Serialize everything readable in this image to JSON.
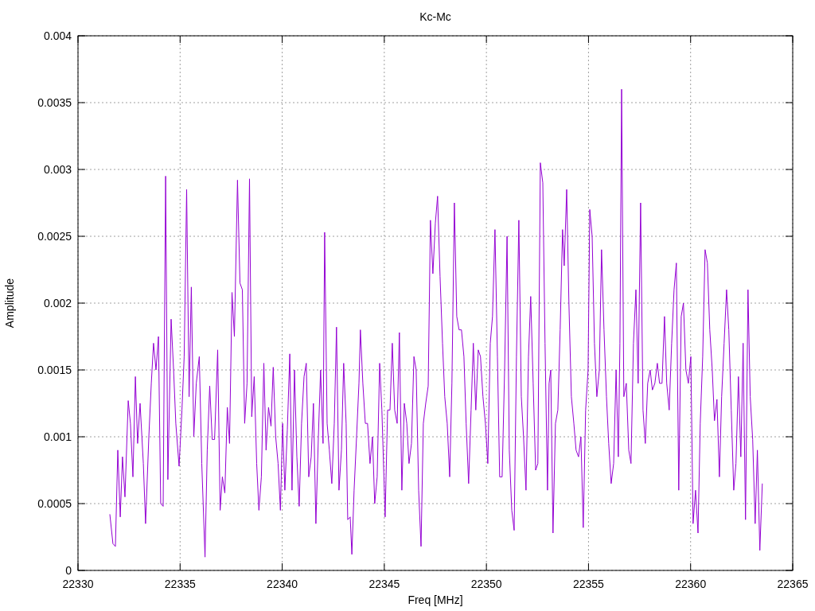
{
  "chart": {
    "chart_data": {
      "type": "line",
      "title": "Kc-Mc",
      "xlabel": "Freq [MHz]",
      "ylabel": "Amplitude",
      "grid": true,
      "xlim": [
        22330,
        22365
      ],
      "ylim": [
        0,
        0.004
      ],
      "xticks": [
        {
          "value": 22330,
          "label": "22330"
        },
        {
          "value": 22335,
          "label": "22335"
        },
        {
          "value": 22340,
          "label": "22340"
        },
        {
          "value": 22345,
          "label": "22345"
        },
        {
          "value": 22350,
          "label": "22350"
        },
        {
          "value": 22355,
          "label": "22355"
        },
        {
          "value": 22360,
          "label": "22360"
        },
        {
          "value": 22365,
          "label": "22365"
        }
      ],
      "yticks": [
        {
          "value": 0,
          "label": "0"
        },
        {
          "value": 0.0005,
          "label": "0.0005"
        },
        {
          "value": 0.001,
          "label": "0.001"
        },
        {
          "value": 0.0015,
          "label": "0.0015"
        },
        {
          "value": 0.002,
          "label": "0.002"
        },
        {
          "value": 0.0025,
          "label": "0.0025"
        },
        {
          "value": 0.003,
          "label": "0.003"
        },
        {
          "value": 0.0035,
          "label": "0.0035"
        },
        {
          "value": 0.004,
          "label": "0.004"
        }
      ],
      "x": [
        22331.56,
        22331.71,
        22331.83,
        22331.95,
        22332.07,
        22332.18,
        22332.3,
        22332.46,
        22332.57,
        22332.69,
        22332.81,
        22332.92,
        22333.04,
        22333.2,
        22333.31,
        22333.47,
        22333.59,
        22333.7,
        22333.82,
        22333.94,
        22334.05,
        22334.17,
        22334.29,
        22334.4,
        22334.56,
        22334.68,
        22334.79,
        22334.95,
        22335.09,
        22335.2,
        22335.32,
        22335.44,
        22335.55,
        22335.67,
        22335.79,
        22335.94,
        22336.06,
        22336.22,
        22336.33,
        22336.45,
        22336.57,
        22336.69,
        22336.84,
        22336.96,
        22337.07,
        22337.19,
        22337.31,
        22337.42,
        22337.54,
        22337.66,
        22337.81,
        22337.93,
        22338.05,
        22338.16,
        22338.28,
        22338.4,
        22338.51,
        22338.63,
        22338.75,
        22338.86,
        22338.98,
        22339.1,
        22339.21,
        22339.33,
        22339.45,
        22339.56,
        22339.68,
        22339.8,
        22339.91,
        22340.02,
        22340.13,
        22340.25,
        22340.37,
        22340.48,
        22340.6,
        22340.72,
        22340.83,
        22340.95,
        22341.07,
        22341.18,
        22341.3,
        22341.42,
        22341.53,
        22341.65,
        22341.77,
        22341.88,
        22342.0,
        22342.08,
        22342.2,
        22342.31,
        22342.43,
        22342.55,
        22342.66,
        22342.78,
        22342.9,
        22343.01,
        22343.13,
        22343.21,
        22343.33,
        22343.41,
        22343.52,
        22343.64,
        22343.76,
        22343.83,
        22343.95,
        22344.07,
        22344.18,
        22344.3,
        22344.42,
        22344.53,
        22344.65,
        22344.77,
        22344.88,
        22345.04,
        22345.16,
        22345.28,
        22345.39,
        22345.51,
        22345.63,
        22345.74,
        22345.86,
        22345.98,
        22346.1,
        22346.21,
        22346.33,
        22346.45,
        22346.56,
        22346.68,
        22346.8,
        22346.91,
        22347.03,
        22347.15,
        22347.26,
        22347.38,
        22347.5,
        22347.61,
        22347.73,
        22347.85,
        22347.96,
        22348.08,
        22348.2,
        22348.31,
        22348.43,
        22348.55,
        22348.66,
        22348.78,
        22348.9,
        22349.01,
        22349.13,
        22349.25,
        22349.36,
        22349.48,
        22349.6,
        22349.71,
        22349.83,
        22349.95,
        22350.07,
        22350.19,
        22350.3,
        22350.42,
        22350.54,
        22350.65,
        22350.77,
        22350.89,
        22351.01,
        22351.12,
        22351.24,
        22351.36,
        22351.47,
        22351.59,
        22351.71,
        22351.82,
        22351.94,
        22352.06,
        22352.17,
        22352.29,
        22352.41,
        22352.52,
        22352.64,
        22352.76,
        22352.87,
        22352.99,
        22353.07,
        22353.15,
        22353.26,
        22353.38,
        22353.5,
        22353.61,
        22353.73,
        22353.81,
        22353.93,
        22354.04,
        22354.16,
        22354.28,
        22354.39,
        22354.51,
        22354.63,
        22354.74,
        22354.86,
        22354.98,
        22355.06,
        22355.18,
        22355.29,
        22355.41,
        22355.53,
        22355.64,
        22355.76,
        22355.88,
        22355.99,
        22356.11,
        22356.23,
        22356.35,
        22356.46,
        22356.54,
        22356.62,
        22356.73,
        22356.85,
        22356.97,
        22357.08,
        22357.2,
        22357.32,
        22357.43,
        22357.55,
        22357.67,
        22357.78,
        22357.9,
        22358.02,
        22358.13,
        22358.25,
        22358.37,
        22358.48,
        22358.6,
        22358.72,
        22358.83,
        22358.95,
        22359.07,
        22359.19,
        22359.3,
        22359.42,
        22359.54,
        22359.65,
        22359.77,
        22359.89,
        22360.01,
        22360.12,
        22360.24,
        22360.36,
        22360.47,
        22360.59,
        22360.71,
        22360.82,
        22360.94,
        22361.06,
        22361.17,
        22361.29,
        22361.41,
        22361.52,
        22361.64,
        22361.76,
        22361.87,
        22361.99,
        22362.11,
        22362.22,
        22362.34,
        22362.46,
        22362.57,
        22362.69,
        22362.81,
        22362.92,
        22363.04,
        22363.16,
        22363.27,
        22363.39,
        22363.51
      ],
      "series": [
        {
          "color": "#9400d3",
          "values": [
            0.00042,
            0.0002,
            0.00018,
            0.0009,
            0.0004,
            0.00085,
            0.00055,
            0.00127,
            0.0011,
            0.0007,
            0.00145,
            0.00095,
            0.00125,
            0.0008,
            0.00035,
            0.001,
            0.0014,
            0.0017,
            0.0015,
            0.00175,
            0.0005,
            0.00048,
            0.00295,
            0.00068,
            0.00188,
            0.0015,
            0.0011,
            0.00078,
            0.0012,
            0.0016,
            0.00285,
            0.0013,
            0.00212,
            0.001,
            0.0014,
            0.0016,
            0.0008,
            0.0001,
            0.0009,
            0.00138,
            0.00098,
            0.00098,
            0.00165,
            0.00045,
            0.0007,
            0.00058,
            0.00122,
            0.00095,
            0.00208,
            0.00175,
            0.00292,
            0.00215,
            0.0021,
            0.0011,
            0.0014,
            0.00293,
            0.00115,
            0.00145,
            0.0008,
            0.00045,
            0.0007,
            0.00155,
            0.0009,
            0.00122,
            0.00108,
            0.00152,
            0.001,
            0.0008,
            0.00045,
            0.0011,
            0.0006,
            0.00105,
            0.00162,
            0.0006,
            0.0015,
            0.00085,
            0.00048,
            0.0011,
            0.00145,
            0.00155,
            0.0007,
            0.00085,
            0.00125,
            0.00035,
            0.001,
            0.0015,
            0.00095,
            0.00253,
            0.0011,
            0.0009,
            0.00065,
            0.0011,
            0.00182,
            0.0006,
            0.0009,
            0.00155,
            0.0011,
            0.00038,
            0.0004,
            0.00012,
            0.0006,
            0.001,
            0.0014,
            0.0018,
            0.0014,
            0.0011,
            0.0011,
            0.0008,
            0.001,
            0.0005,
            0.0007,
            0.00155,
            0.0012,
            0.0004,
            0.0012,
            0.0012,
            0.0017,
            0.0012,
            0.0011,
            0.00178,
            0.0006,
            0.00125,
            0.0011,
            0.0008,
            0.00095,
            0.0016,
            0.0015,
            0.0006,
            0.00018,
            0.0011,
            0.00125,
            0.00138,
            0.00262,
            0.00222,
            0.0026,
            0.0028,
            0.0022,
            0.0017,
            0.0013,
            0.0011,
            0.0007,
            0.0014,
            0.00275,
            0.0019,
            0.0018,
            0.0018,
            0.0016,
            0.0011,
            0.00065,
            0.0012,
            0.0017,
            0.0012,
            0.00165,
            0.0016,
            0.0013,
            0.0011,
            0.0008,
            0.0017,
            0.0019,
            0.00255,
            0.0016,
            0.0007,
            0.0007,
            0.0015,
            0.0025,
            0.0009,
            0.00045,
            0.0003,
            0.0016,
            0.00262,
            0.0013,
            0.001,
            0.0006,
            0.0016,
            0.00205,
            0.0014,
            0.00075,
            0.0008,
            0.00305,
            0.0029,
            0.0017,
            0.0006,
            0.0014,
            0.0015,
            0.00028,
            0.0011,
            0.0012,
            0.0018,
            0.00255,
            0.00228,
            0.00285,
            0.002,
            0.0013,
            0.0011,
            0.0009,
            0.00085,
            0.001,
            0.00032,
            0.0012,
            0.0015,
            0.0027,
            0.0025,
            0.0017,
            0.0013,
            0.0015,
            0.0024,
            0.0018,
            0.0013,
            0.00095,
            0.00065,
            0.0008,
            0.0015,
            0.00085,
            0.0017,
            0.0036,
            0.0013,
            0.0014,
            0.0009,
            0.0008,
            0.0017,
            0.0021,
            0.0014,
            0.00275,
            0.0012,
            0.00095,
            0.0014,
            0.0015,
            0.00135,
            0.0014,
            0.00155,
            0.0014,
            0.0014,
            0.0019,
            0.0014,
            0.0012,
            0.0017,
            0.0021,
            0.0023,
            0.0006,
            0.0019,
            0.002,
            0.0015,
            0.0014,
            0.0016,
            0.00035,
            0.0006,
            0.00028,
            0.0011,
            0.0016,
            0.0024,
            0.0023,
            0.0018,
            0.0015,
            0.00112,
            0.00128,
            0.0007,
            0.0013,
            0.0017,
            0.0021,
            0.0018,
            0.0012,
            0.0006,
            0.0008,
            0.00145,
            0.00085,
            0.0017,
            0.00038,
            0.0021,
            0.0013,
            0.00098,
            0.00035,
            0.0009,
            0.00015,
            0.00065
          ]
        }
      ]
    }
  }
}
